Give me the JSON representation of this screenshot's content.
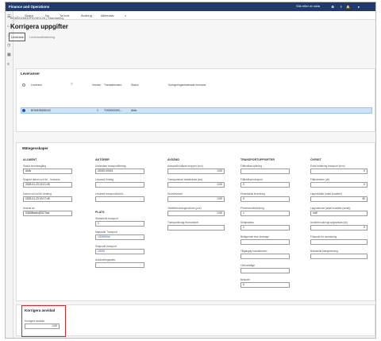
{
  "app": {
    "title": "Finance and Operations",
    "search_placeholder": "Sök efter en sida"
  },
  "toolbar": {
    "save": "Spara",
    "new": "Ny",
    "delete": "Ta bort",
    "edit": "Ändring",
    "options": "Alternativ"
  },
  "page": {
    "breadcrumb": "BOM0026510F6V4KK26 | Standardvy",
    "title": "Korrigera uppgifter"
  },
  "tabs": [
    "Leverans",
    "Leveransfördelning"
  ],
  "deliveries": {
    "title": "Leveranser",
    "columns": [
      "Leverans",
      "Version",
      "Transaktionsnr.",
      "Status",
      "Korrigeringsrelaterade leverans"
    ],
    "rows": [
      {
        "delivery": "BOM10530810C",
        "version": "1",
        "transaction": "TO0000030C...",
        "status": "Aktiv",
        "related": ""
      }
    ]
  },
  "measurements": {
    "title": "Mätegenskaper",
    "general": {
      "header": "ALLMÄNT",
      "status_label": "Status leveransgång",
      "status_value": "Aktiv",
      "created_label": "Skapad datum och tid... leverans",
      "created_value": "2025-01-23 15:21:45",
      "modified_label": "Datum och tid för ändring",
      "modified_value": "2025-01-23 15:17:45",
      "changed_by_label": "Ändrad av",
      "changed_by_value": "D365Batch@DCTest"
    },
    "actors": {
      "header": "AKTÖRER",
      "shipper_label": "Avsändare transportföretag",
      "shipper_value": "02020-00001",
      "delivery_label": "Levande företag",
      "delivery_value": "",
      "receiver_label": "Levande transportörsfört...",
      "receiver_value": "",
      "place_header": "PLATS",
      "start_label": "Startskede transport",
      "start_value": "1",
      "assigned_label": "Mappade Transport",
      "assigned_value": "100000HA",
      "end_label": "Slutpunkt transport",
      "end_value": "10000",
      "reporting_label": "Avsändningsplats",
      "reporting_value": ""
    },
    "sent": {
      "header": "AVSÄND",
      "weight_label": "Ankopsförvaltade skoppet (kvo)",
      "weight_value": "0.00",
      "distance_label": "Transporterad totalsträcka (km)",
      "distance_value": "0.00",
      "actual_label": "Skruvleverad",
      "actual_value": "0.00",
      "total_label": "Totalförbrukningsvolume (pcs)",
      "total_value": "0.00",
      "notes_label": "Transportbolag leverantörer",
      "notes_value": ""
    },
    "transport": {
      "header": "TRANSPORTUPPGIFTER",
      "range_label": "Fältindikat spärring",
      "range_value": "",
      "lane_label": "Fältindikat transport",
      "lane_value": "0",
      "amount_label": "Elmeddelat leverering",
      "amount_value": "0",
      "product_label": "Preveramnfördelning",
      "product_value": "1",
      "stage_label": "Skräpstatus",
      "stage_value": "1",
      "mode_label": "Belägenhet leve leverage",
      "mode_value": "",
      "delivery_label": "Tillgänglig kvantidraden",
      "delivery_value": "",
      "owner_label": "Ombudsläge",
      "owner_value": "",
      "return_label": "Beslutet",
      "return_value": "0"
    },
    "other": {
      "header": "ÖVRIGT",
      "capacity_label": "Extra betalning transport (kvm)",
      "capacity_value": "0",
      "weight_label": "Fältnärheten (vit)",
      "weight_value": "0",
      "loaded_label": "Lappviktfakt (antal kvantitet)",
      "loaded_value": "40",
      "unit_label": "Lappvarkvist (antal kvantitet (antal))",
      "unit_value": "mdf",
      "avg_label": "Anaförbruuknngs avgradslas (sh)",
      "avg_value": "0",
      "free_label": "Fritpunkt för avreskning",
      "free_value": "",
      "fuel_label": "Bränsletid fastighetsning",
      "fuel_value": ""
    }
  },
  "fuel": {
    "title": "Korrigera avvidad",
    "label": "Korrigera avvidad",
    "value": "0.00"
  }
}
